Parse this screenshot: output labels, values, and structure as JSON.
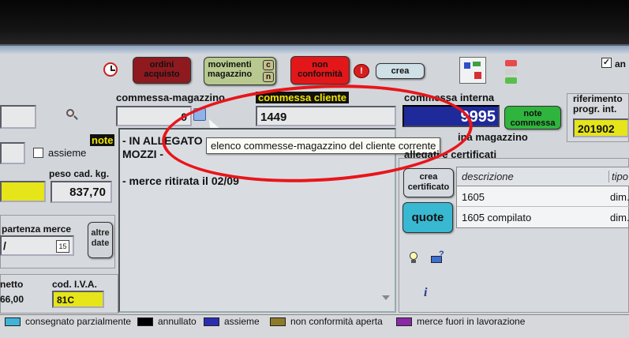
{
  "toolbar": {
    "ordini_acquisto": "ordini\nacquisto",
    "movimenti_magazzino": "movimenti\nmagazzino",
    "movimenti_c": "c",
    "movimenti_n": "n",
    "non_conformita": "non\nconformità",
    "nc_badge": "!",
    "crea": "crea",
    "checkbox_label": "an",
    "checkbox_checked": true
  },
  "header": {
    "commessa_magazzino_label": "commessa-magazzino",
    "commessa_magazzino_value": "0",
    "commessa_cliente_label": "commessa cliente",
    "commessa_cliente_value": "1449",
    "commessa_interna_label": "commessa interna",
    "commessa_interna_value": "9995",
    "note_commessa_button": "note\ncommessa",
    "riferimento_label": "riferimento\nprogr. int.",
    "riferimento_value": "201902"
  },
  "tooltip": {
    "text": "elenco commesse-magazzino del cliente corrente"
  },
  "left": {
    "assieme_label": "assieme",
    "assieme_checked": false,
    "note_label": "note",
    "peso_label": "peso cad. kg.",
    "peso_value": "837,70",
    "partenza_label": "partenza merce",
    "partenza_value": "/",
    "calendar_day": "15",
    "altre_date_button": "altre\ndate",
    "netto_label": "netto",
    "netto_value": "66,00",
    "iva_label": "cod. I.V.A.",
    "iva_value": "81C"
  },
  "notes": {
    "lines": [
      "- IN ALLEGATO",
      "MOZZI -",
      "",
      "- merce ritirata il 02/09"
    ]
  },
  "right": {
    "magazzino_label": "ina magazzino",
    "allegati_label": "allegati e certificati",
    "crea_certificato_button": "crea\ncertificato",
    "quote_button": "quote",
    "table_headers": [
      "descrizione",
      "tipo"
    ],
    "table_rows": [
      [
        "1605",
        "dim."
      ],
      [
        "1605 compilato",
        "dim."
      ]
    ]
  },
  "legend": [
    {
      "label": "consegnato parzialmente",
      "color": "#3fb4d6"
    },
    {
      "label": "annullato",
      "color": "#000000"
    },
    {
      "label": "assieme",
      "color": "#2a2db0"
    },
    {
      "label": "non conformità aperta",
      "color": "#8e7a2a"
    },
    {
      "label": "merce fuori in lavorazione",
      "color": "#8a2aa6"
    }
  ],
  "colors": {
    "annotation_circle": "#e8151a",
    "commessa_interna_bg": "#1e2a9a",
    "yellow_field": "#e6e51a",
    "quote_bg": "#39b8d2"
  }
}
